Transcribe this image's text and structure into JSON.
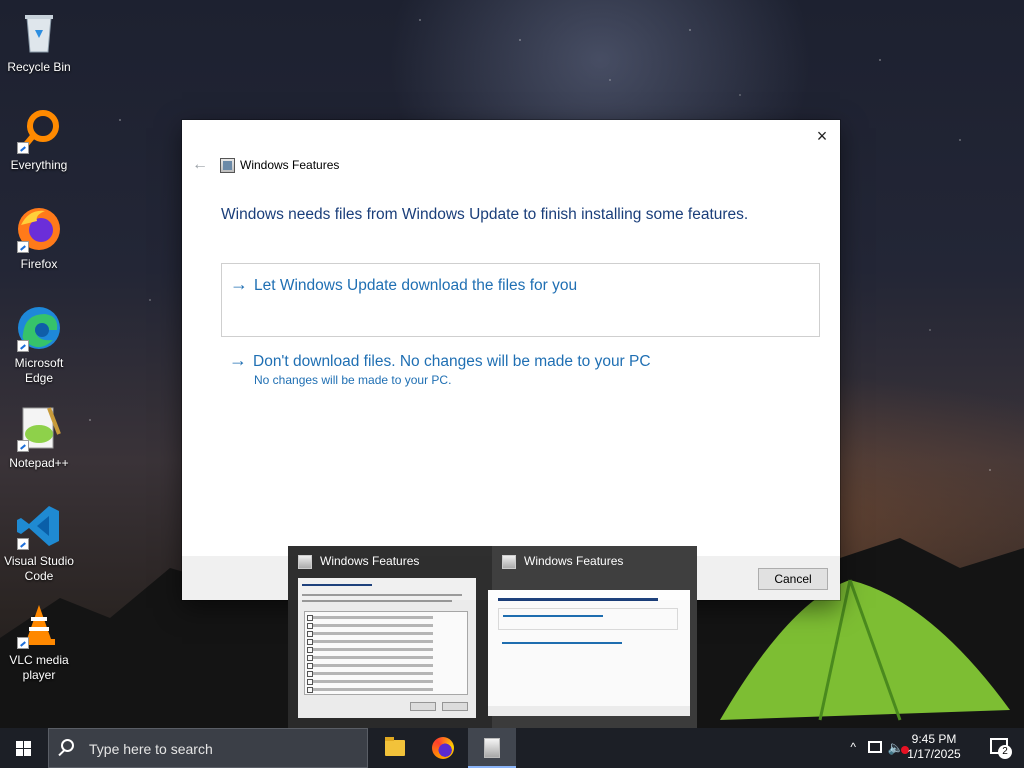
{
  "desktop": {
    "icons": [
      {
        "label": "Recycle Bin"
      },
      {
        "label": "Everything"
      },
      {
        "label": "Firefox"
      },
      {
        "label": "Microsoft Edge"
      },
      {
        "label": "Notepad++"
      },
      {
        "label": "Visual Studio Code"
      },
      {
        "label": "VLC media player"
      }
    ]
  },
  "dialog": {
    "title": "Windows Features",
    "close_icon": "×",
    "back_icon": "←",
    "headline": "Windows needs files from Windows Update to finish installing some features.",
    "option1": "Let Windows Update download the files for you",
    "option2": "Don't download files. No changes will be made to your PC",
    "option2_sub": "No changes will be made to your PC.",
    "cancel": "Cancel",
    "arrow": "→"
  },
  "thumbnails": [
    {
      "title": "Windows Features",
      "icon": "windows-features-icon"
    },
    {
      "title": "Windows Features",
      "icon": "windows-features-icon"
    }
  ],
  "taskbar": {
    "search_placeholder": "Type here to search",
    "apps": [
      {
        "name": "File Explorer",
        "icon": "folder-icon"
      },
      {
        "name": "Firefox",
        "icon": "firefox-icon"
      },
      {
        "name": "Windows Features",
        "icon": "windows-features-icon"
      }
    ],
    "tray": {
      "chevron": "^",
      "time": "9:45 PM",
      "date": "1/17/2025",
      "notifications": "2",
      "volume": "🔈"
    }
  },
  "colors": {
    "accent": "#1f6fb3",
    "headline": "#1a3e7a",
    "taskbar": "#1c1f26"
  }
}
